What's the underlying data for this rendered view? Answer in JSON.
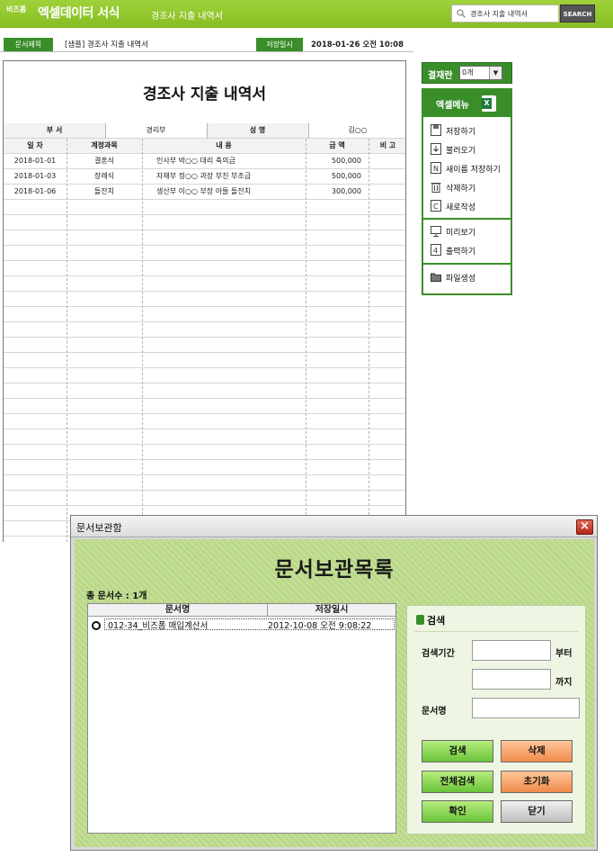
{
  "header": {
    "brand_small": "비즈폼",
    "brand_main": "엑셀데이터 서식",
    "page_name": "경조사 지출 내역서",
    "search": {
      "value": "경조사 지출 내역서",
      "button": "SEARCH"
    }
  },
  "doc_info": {
    "title_label": "문서제목",
    "title_value": "[샘플] 경조사 지출 내역서",
    "saved_label": "저장일시",
    "saved_value": "2018-01-26  오전 10:08"
  },
  "sheet": {
    "title": "경조사 지출 내역서",
    "info_row": {
      "dept_label": "부 서",
      "dept_value": "경리부",
      "name_label": "성 명",
      "name_value": "김○○"
    },
    "columns": [
      "일 자",
      "계정과목",
      "내 용",
      "금 액",
      "비 고"
    ],
    "rows": [
      [
        "2018-01-01",
        "결혼식",
        "인사부 박○○ 대리 축의금",
        "500,000",
        ""
      ],
      [
        "2018-01-03",
        "장례식",
        "자재부 정○○ 과장 부친 부조금",
        "500,000",
        ""
      ],
      [
        "2018-01-06",
        "돌잔치",
        "생산부 이○○ 부장 아들 돌잔치",
        "300,000",
        ""
      ]
    ]
  },
  "right_panel": {
    "kyeoljae_label": "결재란",
    "kyeoljae_value": "0개",
    "menu_title": "엑셀메뉴",
    "menu_group1": [
      "저장하기",
      "불러오기",
      "새이름 저장하기",
      "삭제하기",
      "새로작성"
    ],
    "menu_group2": [
      "미리보기",
      "출력하기"
    ],
    "menu_group3": [
      "파일생성"
    ]
  },
  "dialog": {
    "window_title": "문서보관함",
    "heading": "문서보관목록",
    "count": "총 문서수 : 1개",
    "col_name": "문서명",
    "col_saved": "저장일시",
    "entries": [
      {
        "name": "012-34_비즈폼 매입계산서",
        "saved": "2012-10-08 오전 9:08:22"
      }
    ],
    "search": {
      "title": "검색",
      "period_label": "검색기간",
      "from_suffix": "부터",
      "to_suffix": "까지",
      "docname_label": "문서명"
    },
    "buttons": {
      "search": "검색",
      "delete": "삭제",
      "search_all": "전체검색",
      "reset": "초기화",
      "ok": "확인",
      "close": "닫기"
    }
  }
}
